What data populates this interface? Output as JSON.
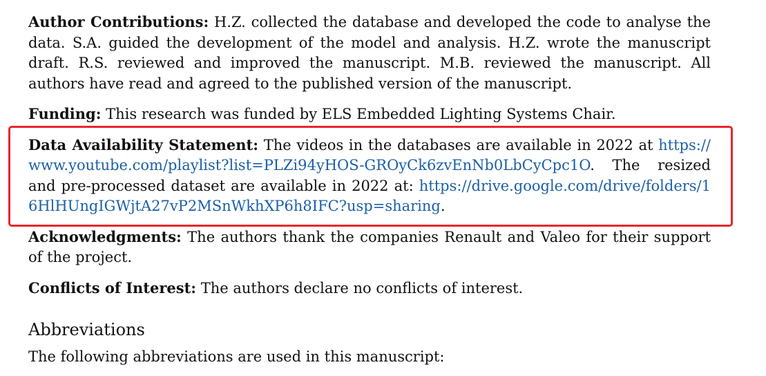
{
  "author_contributions": {
    "label": "Author Contributions:",
    "text": " H.Z. collected the database and developed the code to analyse the data. S.A. guided the development of the model and analysis. H.Z. wrote the manuscript draft. R.S. reviewed and improved the manuscript. M.B. reviewed the manuscript. All authors have read and agreed to the published version of the manuscript."
  },
  "funding": {
    "label": "Funding:",
    "text": " This research was funded by ELS Embedded Lighting Systems Chair."
  },
  "data_availability": {
    "label": "Data Availability Statement:",
    "text_1": " The videos in the databases are available in 2022 at ",
    "link_1": "https://www.youtube.com/playlist?list=PLZi94yHOS-GROyCk6zvEnNb0LbCyCpc1O",
    "text_2": ". The resized and pre-processed dataset are available in 2022 at: ",
    "link_2": "https://drive.google.com/drive/folders/16HlHUngIGWjtA27vP2MSnWkhXP6h8IFC?usp=sharing",
    "text_3": ".",
    "highlight_color": "#e8272b",
    "link_color": "#1a5fa8"
  },
  "acknowledgments": {
    "label": "Acknowledgments:",
    "text": " The authors thank the companies Renault and Valeo for their support of the project."
  },
  "conflicts": {
    "label": "Conflicts of Interest:",
    "text": " The authors declare no conflicts of interest."
  },
  "abbreviations": {
    "heading": "Abbreviations",
    "intro": "The following abbreviations are used in this manuscript:"
  }
}
